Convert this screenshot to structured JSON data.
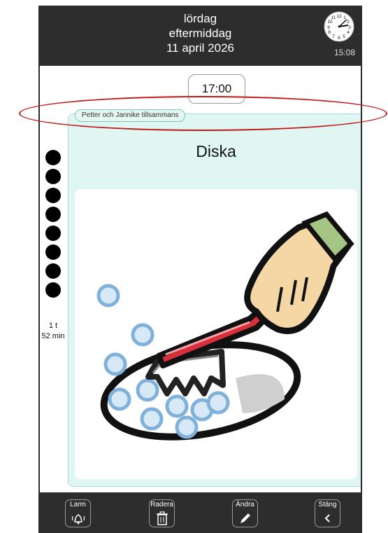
{
  "header": {
    "day": "lördag",
    "period": "eftermiddag",
    "date": "11 april 2026",
    "clock_time": "15:08"
  },
  "activity": {
    "time": "17:00",
    "participants": "Petter och Jannike tillsammans",
    "title": "Diska",
    "image_icon": "dishwashing-picture"
  },
  "countdown": {
    "dots": 8,
    "hours": "1 t",
    "minutes": "52 min"
  },
  "toolbar": {
    "alarm": "Larm",
    "delete": "Radera",
    "edit": "Ändra",
    "close": "Stäng"
  },
  "colors": {
    "header_bg": "#2d2d2d",
    "card_bg": "#dff6f2",
    "highlight": "#c01818"
  }
}
